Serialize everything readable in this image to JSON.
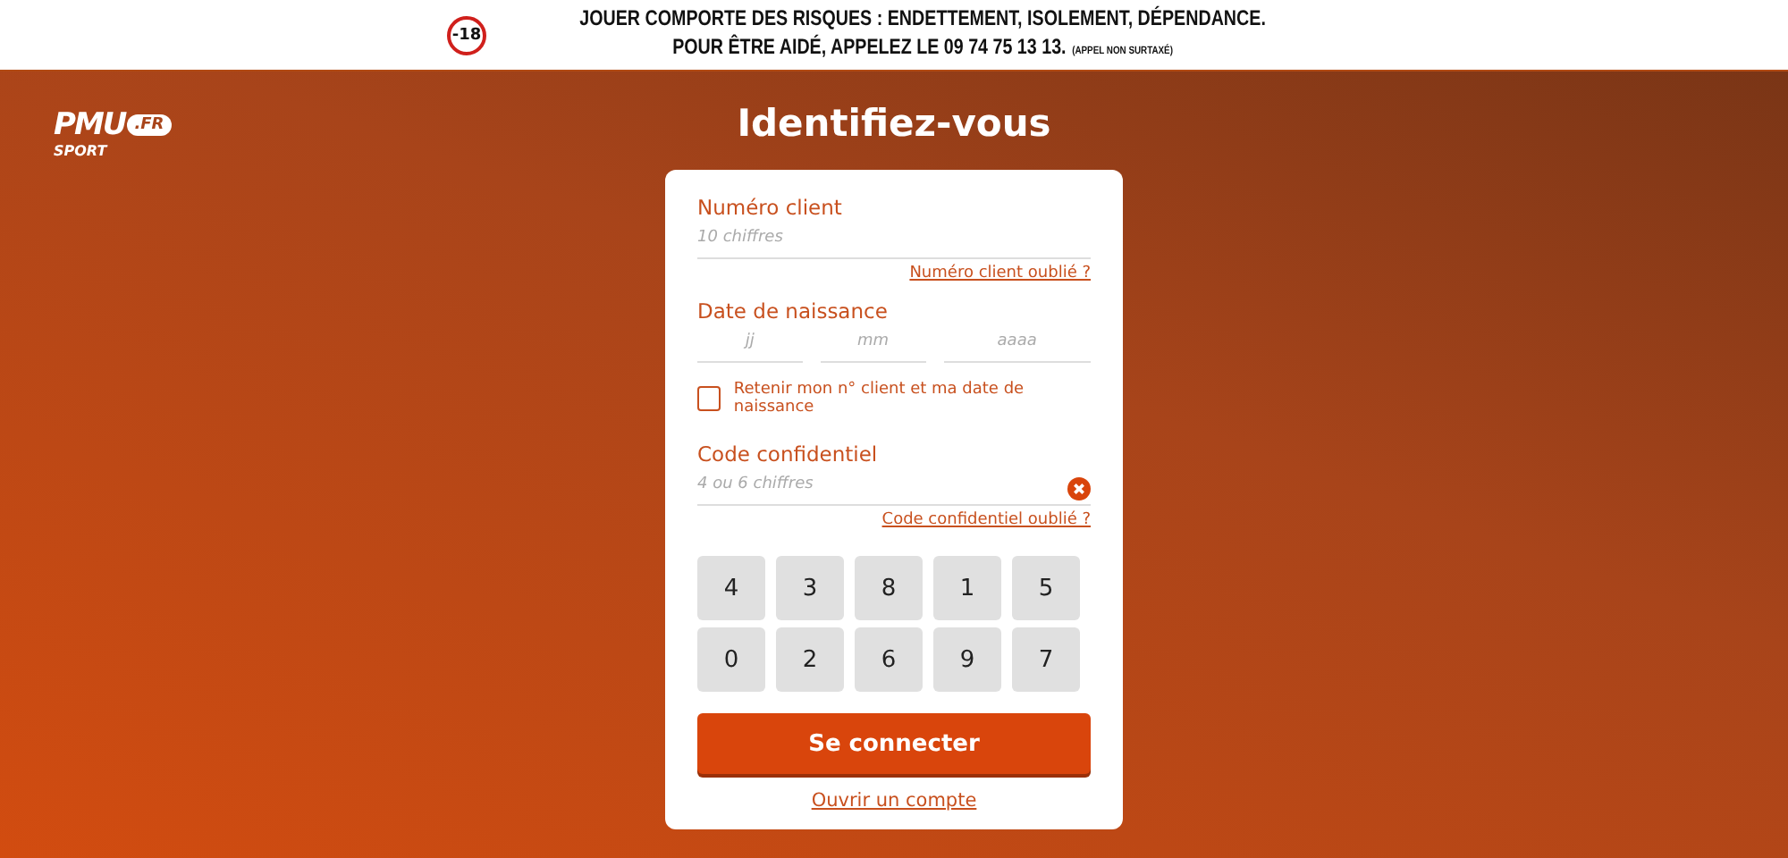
{
  "banner": {
    "age_badge": "-18",
    "line_1": "JOUER COMPORTE DES RISQUES : ENDETTEMENT, ISOLEMENT, DÉPENDANCE.",
    "line_2": "POUR ÊTRE AIDÉ, APPELEZ LE 09 74 75 13 13.",
    "line_2_note": "(APPEL NON SURTAXÉ)"
  },
  "logo": {
    "brand": "PMU",
    "suffix": ".FR",
    "subtitle": "SPORT"
  },
  "title": "Identifiez-vous",
  "form": {
    "client_number": {
      "label": "Numéro client",
      "placeholder": "10 chiffres",
      "forgot_link": "Numéro client oublié ?"
    },
    "birth_date": {
      "label": "Date de naissance",
      "fields": [
        {
          "placeholder": "jj"
        },
        {
          "placeholder": "mm"
        },
        {
          "placeholder": "aaaa"
        }
      ]
    },
    "remember": {
      "label": "Retenir mon n° client et ma date de naissance",
      "checked": false
    },
    "pin": {
      "label": "Code confidentiel",
      "placeholder": "4 ou 6 chiffres",
      "forgot_link": "Code confidentiel oublié ?"
    },
    "keypad": [
      [
        "4",
        "3",
        "8",
        "1",
        "5"
      ],
      [
        "0",
        "2",
        "6",
        "9",
        "7"
      ]
    ],
    "submit": "Se connecter",
    "create_account_link": "Ouvrir un compte"
  }
}
